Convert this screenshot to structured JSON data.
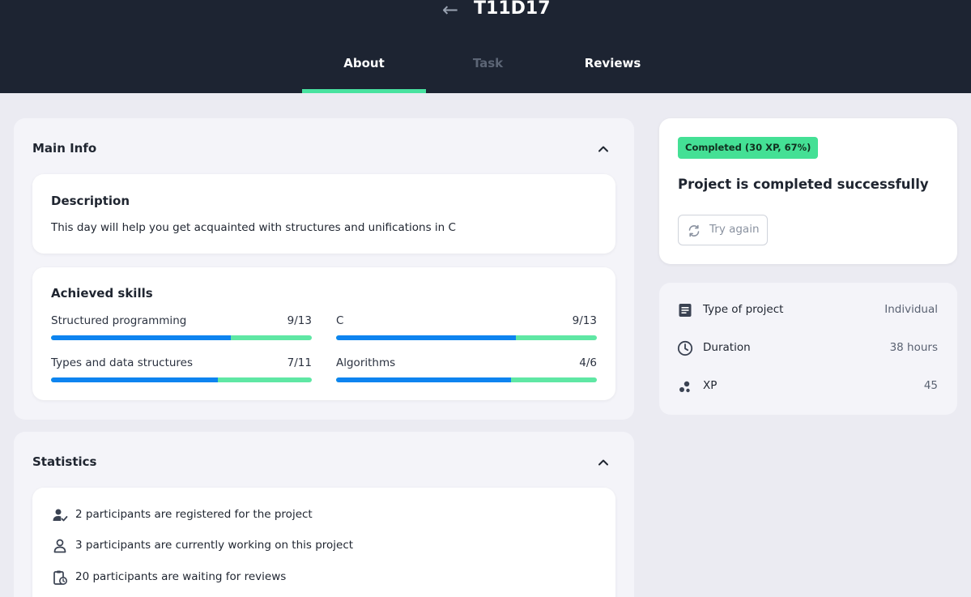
{
  "header": {
    "back_icon": "arrow-left-icon",
    "title": "T11D17",
    "tabs": [
      {
        "label": "About",
        "state": "active"
      },
      {
        "label": "Task",
        "state": "disabled"
      },
      {
        "label": "Reviews",
        "state": "normal"
      }
    ]
  },
  "main_info": {
    "title": "Main Info",
    "description": {
      "title": "Description",
      "text": "This day will help you get acquainted with structures and unifications in C"
    },
    "skills": {
      "title": "Achieved skills",
      "items": [
        {
          "label": "Structured programming",
          "value": "9/13",
          "fraction": 0.69
        },
        {
          "label": "C",
          "value": "9/13",
          "fraction": 0.69
        },
        {
          "label": "Types and data structures",
          "value": "7/11",
          "fraction": 0.64
        },
        {
          "label": "Algorithms",
          "value": "4/6",
          "fraction": 0.67
        }
      ]
    }
  },
  "statistics": {
    "title": "Statistics",
    "items": [
      {
        "icon": "user-check-icon",
        "text": "2 participants are registered for the project"
      },
      {
        "icon": "user-icon",
        "text": "3 participants are currently working on this project"
      },
      {
        "icon": "clipboard-clock-icon",
        "text": "20 participants are waiting for reviews"
      }
    ]
  },
  "status": {
    "badge": "Completed (30 XP, 67%)",
    "title": "Project is completed successfully",
    "retry_label": "Try again"
  },
  "project_info": [
    {
      "icon": "document-icon",
      "label": "Type of project",
      "value": "Individual"
    },
    {
      "icon": "clock-icon",
      "label": "Duration",
      "value": "38 hours"
    },
    {
      "icon": "xp-icon",
      "label": "XP",
      "value": "45"
    }
  ],
  "colors": {
    "header_bg": "#1d2432",
    "accent_green": "#48e2a0",
    "progress_blue": "#0e84f0",
    "badge_green": "#44e095"
  }
}
